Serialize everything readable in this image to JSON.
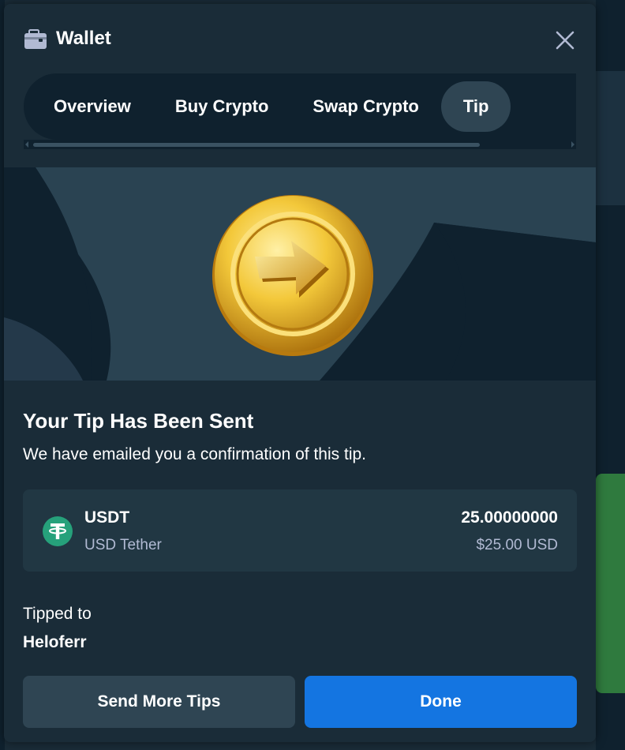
{
  "modal": {
    "title": "Wallet",
    "icons": {
      "wallet": "wallet-icon",
      "close": "close-icon"
    }
  },
  "tabs": [
    {
      "label": "Overview",
      "active": false
    },
    {
      "label": "Buy Crypto",
      "active": false
    },
    {
      "label": "Swap Crypto",
      "active": false
    },
    {
      "label": "Tip",
      "active": true
    }
  ],
  "confirmation": {
    "heading": "Your Tip Has Been Sent",
    "message": "We have emailed you a confirmation of this tip.",
    "hero_icon": "gold-coin-arrow-icon"
  },
  "tip": {
    "currency_code": "USDT",
    "currency_name": "USD Tether",
    "currency_icon": "tether-icon",
    "amount": "25.00000000",
    "amount_usd": "$25.00 USD",
    "recipient_label": "Tipped to",
    "recipient": "Heloferr"
  },
  "actions": {
    "send_more_label": "Send More Tips",
    "done_label": "Done"
  },
  "colors": {
    "background": "#1a2c38",
    "tabs_background": "#0f212e",
    "active_tab": "#2f4553",
    "primary_button": "#1475e1",
    "secondary_button": "#2f4553",
    "muted_text": "#b1bad3",
    "tether_green": "#26a17b",
    "coin_gold": "#e9b323"
  }
}
